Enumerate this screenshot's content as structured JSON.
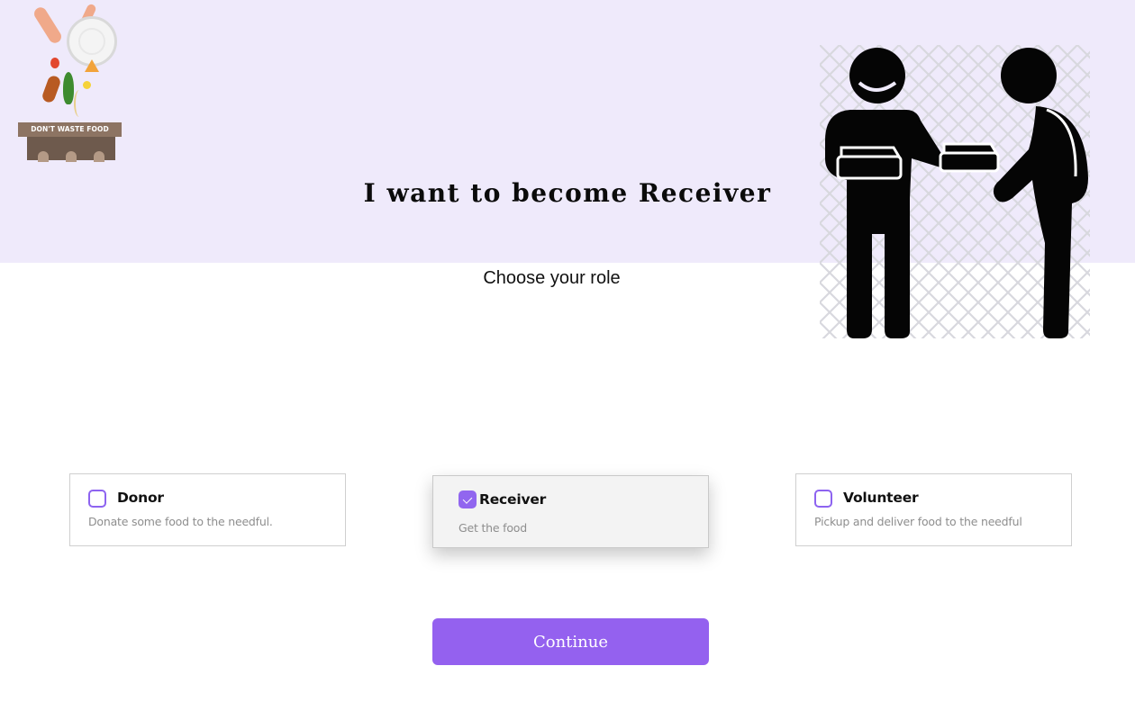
{
  "logo": {
    "icon": "dont-waste-food-logo",
    "sign_text": "DON'T WASTE FOOD"
  },
  "header": {
    "title": "I want to become Receiver"
  },
  "main": {
    "subtitle": "Choose your role",
    "illustration": "food-sharing-people-icon",
    "roles": [
      {
        "title": "Donor",
        "description": "Donate some food to the needful.",
        "checked": false
      },
      {
        "title": "Receiver",
        "description": "Get the food",
        "checked": true
      },
      {
        "title": "Volunteer",
        "description": "Pickup and deliver food to the needful",
        "checked": false
      }
    ],
    "continue_label": "Continue"
  },
  "colors": {
    "accent": "#9461ef",
    "hero_background": "#efeafb",
    "card_border": "#cfcfcf",
    "muted_text": "#8e8e8e"
  }
}
